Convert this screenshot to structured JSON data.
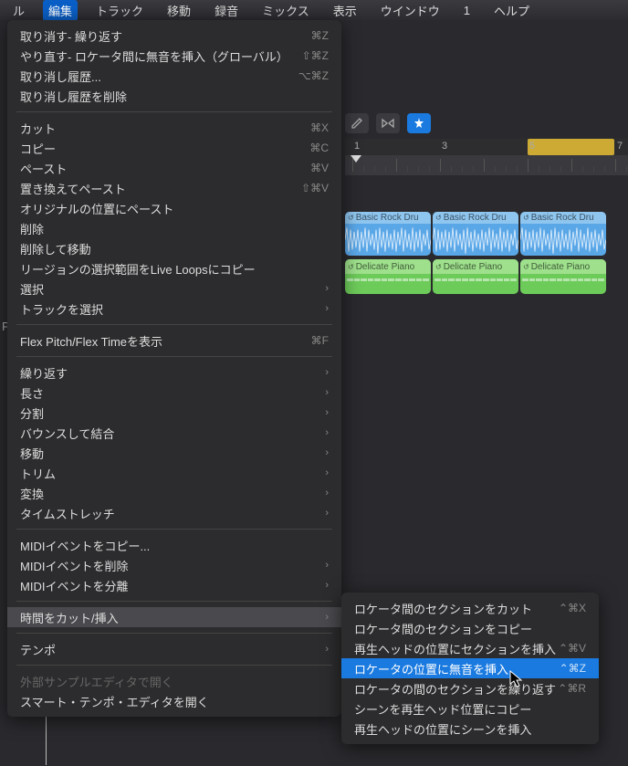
{
  "menubar": {
    "items": [
      "ル",
      "編集",
      "トラック",
      "移動",
      "録音",
      "ミックス",
      "表示",
      "ウインドウ",
      "1",
      "ヘルプ"
    ],
    "active_index": 1
  },
  "dropdown": {
    "groups": [
      [
        {
          "label": "取り消す- 繰り返す",
          "shortcut": "⌘Z",
          "arrow": false
        },
        {
          "label": "やり直す- ロケータ間に無音を挿入（グローバル）",
          "shortcut": "⇧⌘Z",
          "arrow": false
        },
        {
          "label": "取り消し履歴...",
          "shortcut": "⌥⌘Z",
          "arrow": false
        },
        {
          "label": "取り消し履歴を削除",
          "shortcut": "",
          "arrow": false
        }
      ],
      [
        {
          "label": "カット",
          "shortcut": "⌘X",
          "arrow": false
        },
        {
          "label": "コピー",
          "shortcut": "⌘C",
          "arrow": false
        },
        {
          "label": "ペースト",
          "shortcut": "⌘V",
          "arrow": false
        },
        {
          "label": "置き換えてペースト",
          "shortcut": "⇧⌘V",
          "arrow": false
        },
        {
          "label": "オリジナルの位置にペースト",
          "shortcut": "",
          "arrow": false
        },
        {
          "label": "削除",
          "shortcut": "",
          "arrow": false
        },
        {
          "label": "削除して移動",
          "shortcut": "",
          "arrow": false
        },
        {
          "label": "リージョンの選択範囲をLive Loopsにコピー",
          "shortcut": "",
          "arrow": false
        },
        {
          "label": "選択",
          "shortcut": "",
          "arrow": true
        },
        {
          "label": "トラックを選択",
          "shortcut": "",
          "arrow": true
        }
      ],
      [
        {
          "label": "Flex Pitch/Flex Timeを表示",
          "shortcut": "⌘F",
          "arrow": false
        }
      ],
      [
        {
          "label": "繰り返す",
          "shortcut": "",
          "arrow": true
        },
        {
          "label": "長さ",
          "shortcut": "",
          "arrow": true
        },
        {
          "label": "分割",
          "shortcut": "",
          "arrow": true
        },
        {
          "label": "バウンスして結合",
          "shortcut": "",
          "arrow": true
        },
        {
          "label": "移動",
          "shortcut": "",
          "arrow": true
        },
        {
          "label": "トリム",
          "shortcut": "",
          "arrow": true
        },
        {
          "label": "変換",
          "shortcut": "",
          "arrow": true
        },
        {
          "label": "タイムストレッチ",
          "shortcut": "",
          "arrow": true
        }
      ],
      [
        {
          "label": "MIDIイベントをコピー...",
          "shortcut": "",
          "arrow": false
        },
        {
          "label": "MIDIイベントを削除",
          "shortcut": "",
          "arrow": true
        },
        {
          "label": "MIDIイベントを分離",
          "shortcut": "",
          "arrow": true
        }
      ],
      [
        {
          "label": "時間をカット/挿入",
          "shortcut": "",
          "arrow": true,
          "highlighted": true
        }
      ],
      [
        {
          "label": "テンポ",
          "shortcut": "",
          "arrow": true
        }
      ],
      [
        {
          "label": "外部サンプルエディタで開く",
          "shortcut": "",
          "arrow": false,
          "disabled": true
        },
        {
          "label": "スマート・テンポ・エディタを開く",
          "shortcut": "",
          "arrow": false
        }
      ]
    ]
  },
  "submenu": {
    "items": [
      {
        "label": "ロケータ間のセクションをカット",
        "shortcut": "⌃⌘X"
      },
      {
        "label": "ロケータ間のセクションをコピー",
        "shortcut": ""
      },
      {
        "label": "再生ヘッドの位置にセクションを挿入",
        "shortcut": "⌃⌘V"
      },
      {
        "label": "ロケータの位置に無音を挿入",
        "shortcut": "⌃⌘Z",
        "selected": true
      },
      {
        "label": "ロケータの間のセクションを繰り返す",
        "shortcut": "⌃⌘R"
      },
      {
        "label": "シーンを再生ヘッド位置にコピー",
        "shortcut": ""
      },
      {
        "label": "再生ヘッドの位置にシーンを挿入",
        "shortcut": ""
      }
    ]
  },
  "ruler": {
    "nums": [
      "1",
      "3",
      "5",
      "7"
    ]
  },
  "regions": {
    "drums_label": "Basic Rock Dru",
    "piano_label": "Delicate Piano"
  },
  "sidebar_letter": "P"
}
